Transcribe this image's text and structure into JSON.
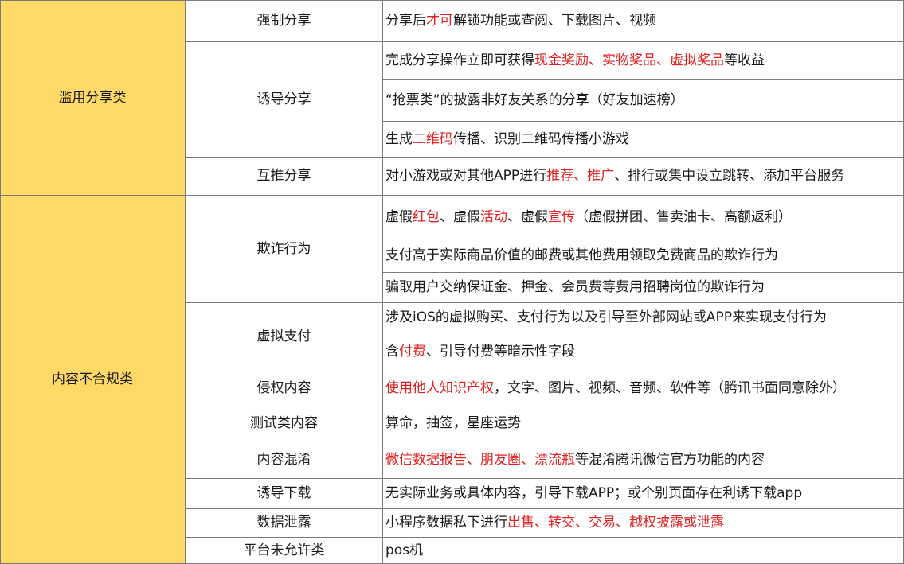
{
  "highlight_color": "#e02020",
  "category_color": "#FFD966",
  "categories": [
    {
      "label": "滥用分享类"
    },
    {
      "label": "内容不合规类"
    }
  ],
  "subcategories": [
    {
      "label": "强制分享"
    },
    {
      "label": "诱导分享"
    },
    {
      "label": "互推分享"
    },
    {
      "label": "欺诈行为"
    },
    {
      "label": "虚拟支付"
    },
    {
      "label": "侵权内容"
    },
    {
      "label": "测试类内容"
    },
    {
      "label": "内容混淆"
    },
    {
      "label": "诱导下载"
    },
    {
      "label": "数据泄露"
    },
    {
      "label": "平台未允许类"
    }
  ],
  "rows": [
    {
      "segments": [
        {
          "text": "分享后",
          "hl": false
        },
        {
          "text": "才可",
          "hl": true
        },
        {
          "text": "解锁功能或查阅、下载图片、视频",
          "hl": false
        }
      ]
    },
    {
      "segments": [
        {
          "text": "完成分享操作立即可获得",
          "hl": false
        },
        {
          "text": "现金奖励、实物奖品、虚拟奖品",
          "hl": true
        },
        {
          "text": "等收益",
          "hl": false
        }
      ]
    },
    {
      "segments": [
        {
          "text": "“抢票类”的披露非好友关系的分享（好友加速榜）",
          "hl": false
        }
      ]
    },
    {
      "segments": [
        {
          "text": "生成",
          "hl": false
        },
        {
          "text": "二维码",
          "hl": true
        },
        {
          "text": "传播、识别二维码传播小游戏",
          "hl": false
        }
      ]
    },
    {
      "segments": [
        {
          "text": "对小游戏或对其他APP进行",
          "hl": false
        },
        {
          "text": "推荐、推广",
          "hl": true
        },
        {
          "text": "、排行或集中设立跳转、添加平台服务",
          "hl": false
        }
      ]
    },
    {
      "segments": [
        {
          "text": "虚假",
          "hl": false
        },
        {
          "text": "红包",
          "hl": true
        },
        {
          "text": "、虚假",
          "hl": false
        },
        {
          "text": "活动",
          "hl": true
        },
        {
          "text": "、虚假",
          "hl": false
        },
        {
          "text": "宣传",
          "hl": true
        },
        {
          "text": "（虚假拼团、售卖油卡、高额返利）",
          "hl": false
        }
      ]
    },
    {
      "segments": [
        {
          "text": "支付高于实际商品价值的邮费或其他费用领取免费商品的欺诈行为",
          "hl": false
        }
      ]
    },
    {
      "segments": [
        {
          "text": "骗取用户交纳保证金、押金、会员费等费用招聘岗位的欺诈行为",
          "hl": false
        }
      ]
    },
    {
      "segments": [
        {
          "text": "涉及iOS的虚拟购买、支付行为以及引导至外部网站或APP来实现支付行为",
          "hl": false
        }
      ]
    },
    {
      "segments": [
        {
          "text": "含",
          "hl": false
        },
        {
          "text": "付费",
          "hl": true
        },
        {
          "text": "、引导付费等暗示性字段",
          "hl": false
        }
      ]
    },
    {
      "segments": [
        {
          "text": "使用他人知识产权",
          "hl": true
        },
        {
          "text": "，文字、图片、视频、音频、软件等（腾讯书面同意除外）",
          "hl": false
        }
      ]
    },
    {
      "segments": [
        {
          "text": "算命，抽签，星座运势",
          "hl": false
        }
      ]
    },
    {
      "segments": [
        {
          "text": "微信数据报告、朋友圈、漂流瓶",
          "hl": true
        },
        {
          "text": "等混淆腾讯微信官方功能的内容",
          "hl": false
        }
      ]
    },
    {
      "segments": [
        {
          "text": "无实际业务或具体内容，引导下载APP；或个别页面存在利诱下载app",
          "hl": false
        }
      ]
    },
    {
      "segments": [
        {
          "text": "小程序数据私下进行",
          "hl": false
        },
        {
          "text": "出售、转交、交易、越权披露或泄露",
          "hl": true
        }
      ]
    },
    {
      "segments": [
        {
          "text": "pos机",
          "hl": false
        }
      ]
    }
  ]
}
